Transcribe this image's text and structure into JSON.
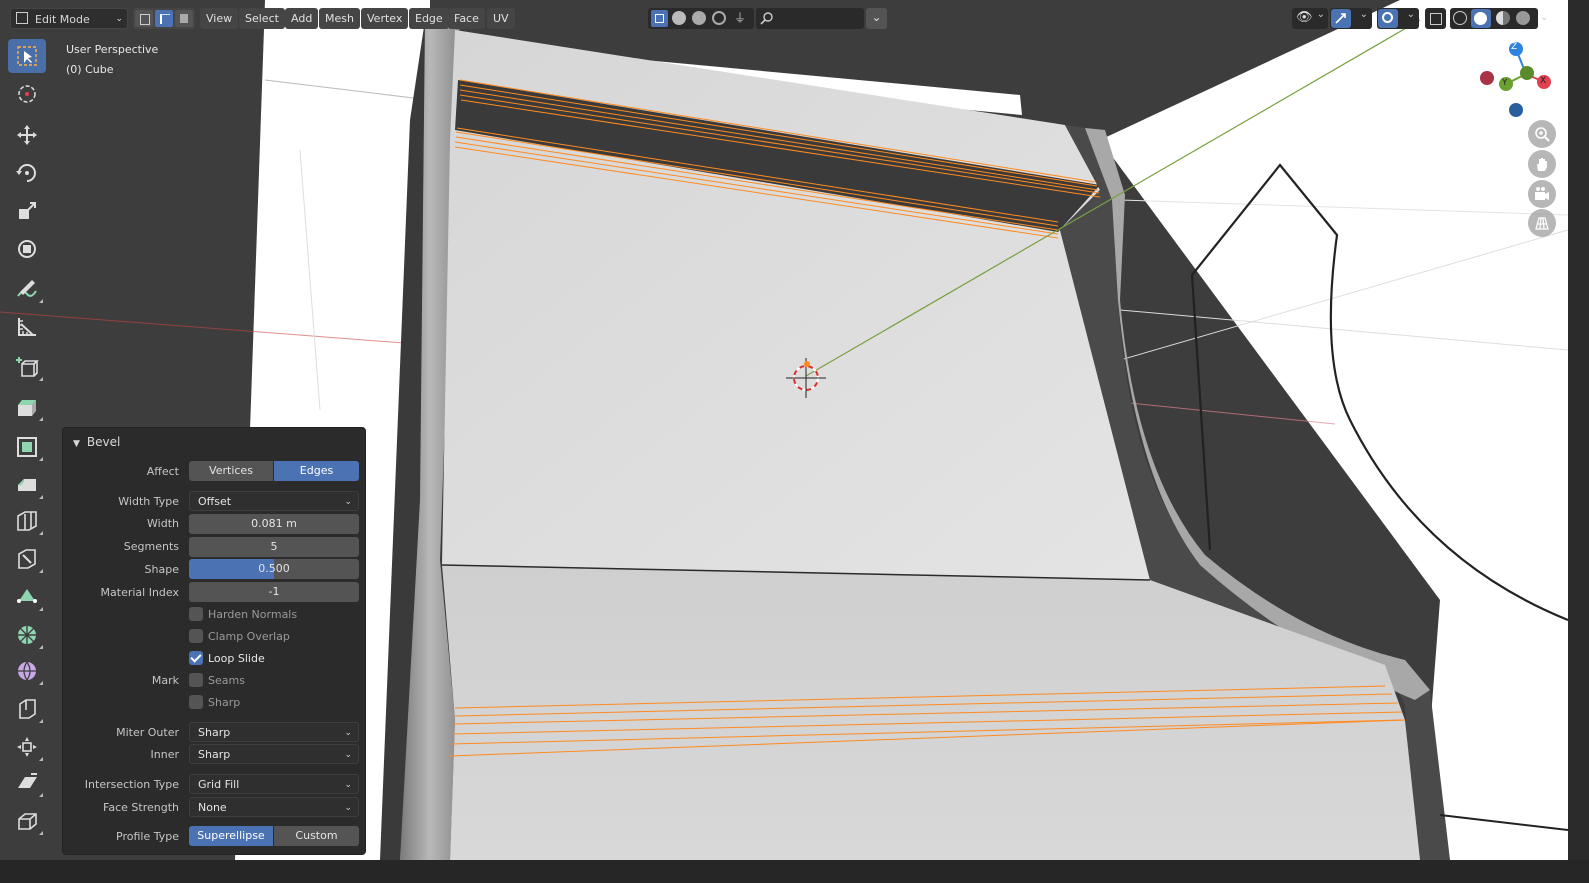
{
  "header": {
    "mode_select": "Edit Mode",
    "menus": [
      "View",
      "Select",
      "Add",
      "Mesh",
      "Vertex",
      "Edge",
      "Face",
      "UV"
    ],
    "selection_modes": [
      "vertex-select-icon",
      "edge-select-icon",
      "face-select-icon"
    ],
    "active_selection_mode": "edge-select-icon"
  },
  "viewport": {
    "view_name": "User Perspective",
    "object_name": "(0) Cube"
  },
  "toolbar": {
    "tools": [
      "select-box-icon",
      "cursor-icon",
      "move-icon",
      "rotate-icon",
      "scale-icon",
      "transform-icon",
      "annotate-icon",
      "measure-icon",
      "add-cube-icon",
      "extrude-region-icon",
      "inset-faces-icon",
      "bevel-icon",
      "loop-cut-icon",
      "knife-icon",
      "poly-build-icon",
      "spin-icon",
      "smooth-icon",
      "edge-slide-icon",
      "shrink-fatten-icon",
      "shear-icon",
      "rip-region-icon"
    ],
    "active_tool": "select-box-icon"
  },
  "gizmo": {
    "axes": [
      "Z",
      "Y",
      "X"
    ]
  },
  "navigation": [
    "zoom-icon",
    "pan-hand-icon",
    "camera-view-icon",
    "ortho-grid-icon"
  ],
  "bevel_panel": {
    "title": "Bevel",
    "affect": {
      "label": "Affect",
      "options": [
        "Vertices",
        "Edges"
      ],
      "selected": "Edges"
    },
    "width_type": {
      "label": "Width Type",
      "value": "Offset"
    },
    "width": {
      "label": "Width",
      "value": "0.081 m"
    },
    "segments": {
      "label": "Segments",
      "value": "5"
    },
    "shape": {
      "label": "Shape",
      "value": "0.500",
      "fraction": 0.5
    },
    "material_index": {
      "label": "Material Index",
      "value": "-1"
    },
    "harden_normals": {
      "label": "Harden Normals",
      "checked": false
    },
    "clamp_overlap": {
      "label": "Clamp Overlap",
      "checked": false
    },
    "loop_slide": {
      "label": "Loop Slide",
      "checked": true
    },
    "mark": {
      "label": "Mark",
      "seams": "Seams",
      "sharp": "Sharp",
      "seams_checked": false,
      "sharp_checked": false
    },
    "miter_outer": {
      "label": "Miter Outer",
      "value": "Sharp"
    },
    "miter_inner": {
      "label": "Inner",
      "value": "Sharp"
    },
    "intersection_type": {
      "label": "Intersection Type",
      "value": "Grid Fill"
    },
    "face_strength": {
      "label": "Face Strength",
      "value": "None"
    },
    "profile_type": {
      "label": "Profile Type",
      "options": [
        "Superellipse",
        "Custom"
      ],
      "selected": "Superellipse"
    }
  },
  "colors": {
    "selection_orange": "#ff8a1f",
    "active_blue": "#4b72b3",
    "panel_bg": "#2b2b2b",
    "x_axis": "#e0404f",
    "y_axis": "#6aa130",
    "z_axis": "#2f83e0"
  }
}
